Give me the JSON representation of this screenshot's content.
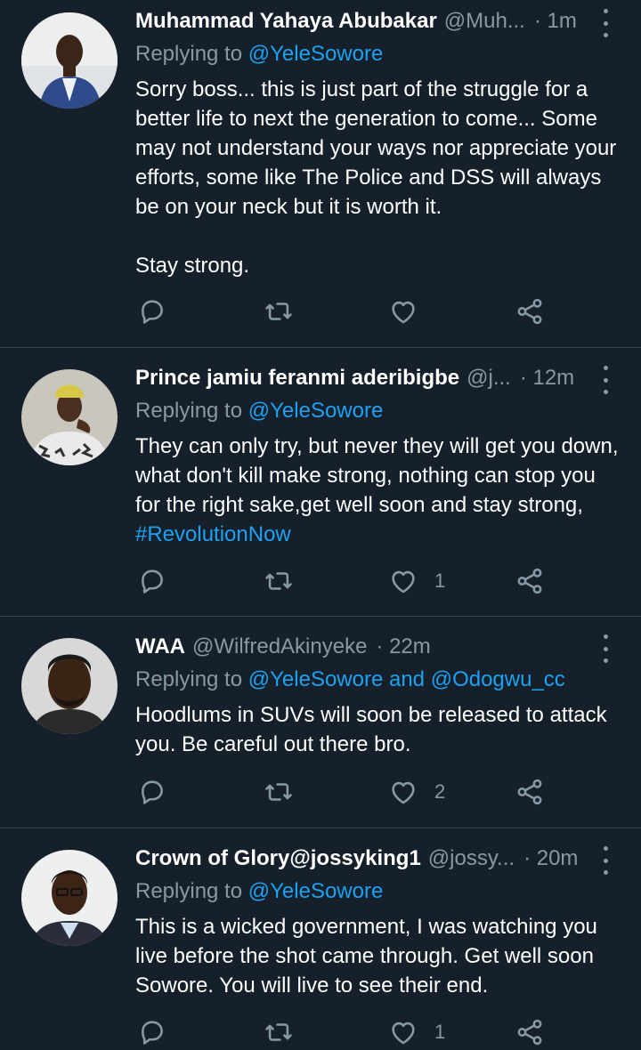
{
  "tweets": [
    {
      "name": "Muhammad Yahaya Abubakar",
      "handle": "@Muh...",
      "time": "· 1m",
      "reply_prefix": "Replying to",
      "reply_to": "@YeleSowore",
      "text": "Sorry boss... this is just part of the struggle for a better life to next the generation to come... Some may not understand your ways nor appreciate your efforts, some like The Police and DSS will always be on your neck but it is worth it.\n\nStay strong.",
      "like_count": ""
    },
    {
      "name": "Prince jamiu feranmi aderibigbe",
      "handle": "@j...",
      "time": "· 12m",
      "reply_prefix": "Replying to",
      "reply_to": "@YeleSowore",
      "text": "They can only try, but never they will get you down, what don't kill make strong, nothing can stop you for the right sake,get well soon and stay strong, ",
      "hashtag": "#RevolutionNow",
      "like_count": "1"
    },
    {
      "name": "WAA",
      "handle": "@WilfredAkinyeke",
      "time": "· 22m",
      "reply_prefix": "Replying to",
      "reply_to": "@YeleSowore and @Odogwu_cc",
      "text": "Hoodlums in SUVs will soon be released to attack you. Be careful out there bro.",
      "like_count": "2"
    },
    {
      "name": "Crown of Glory@jossyking1",
      "handle": "@jossy...",
      "time": "· 20m",
      "reply_prefix": "Replying to",
      "reply_to": "@YeleSowore",
      "text": "This is a wicked government, I was watching you live before the shot came through. Get well soon Sowore. You will live to see their end.",
      "like_count": "1"
    }
  ],
  "colors": {
    "background": "#15202b",
    "divider": "#38444d",
    "muted": "#8899a6",
    "accent": "#1da1f2"
  },
  "icons": [
    "reply-icon",
    "retweet-icon",
    "like-icon",
    "share-icon",
    "more-icon"
  ]
}
